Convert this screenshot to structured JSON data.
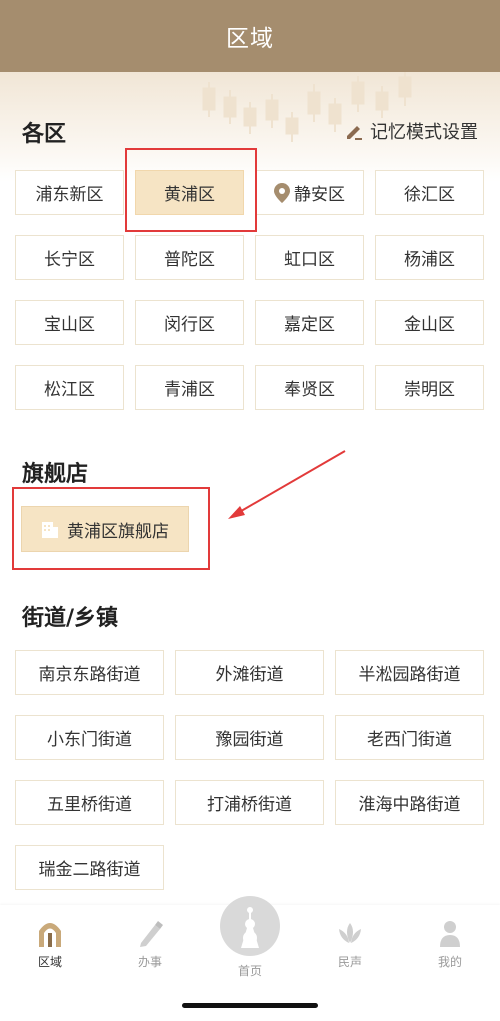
{
  "header": {
    "title": "区域"
  },
  "districts": {
    "title": "各区",
    "memory_setting": "记忆模式设置",
    "items": [
      {
        "label": "浦东新区",
        "selected": false,
        "icon": ""
      },
      {
        "label": "黄浦区",
        "selected": true,
        "icon": ""
      },
      {
        "label": "静安区",
        "selected": false,
        "icon": "location-pin-icon"
      },
      {
        "label": "徐汇区",
        "selected": false,
        "icon": ""
      },
      {
        "label": "长宁区",
        "selected": false,
        "icon": ""
      },
      {
        "label": "普陀区",
        "selected": false,
        "icon": ""
      },
      {
        "label": "虹口区",
        "selected": false,
        "icon": ""
      },
      {
        "label": "杨浦区",
        "selected": false,
        "icon": ""
      },
      {
        "label": "宝山区",
        "selected": false,
        "icon": ""
      },
      {
        "label": "闵行区",
        "selected": false,
        "icon": ""
      },
      {
        "label": "嘉定区",
        "selected": false,
        "icon": ""
      },
      {
        "label": "金山区",
        "selected": false,
        "icon": ""
      },
      {
        "label": "松江区",
        "selected": false,
        "icon": ""
      },
      {
        "label": "青浦区",
        "selected": false,
        "icon": ""
      },
      {
        "label": "奉贤区",
        "selected": false,
        "icon": ""
      },
      {
        "label": "崇明区",
        "selected": false,
        "icon": ""
      }
    ]
  },
  "flagship": {
    "title": "旗舰店",
    "store_label": "黄浦区旗舰店",
    "icon": "building-icon"
  },
  "streets": {
    "title": "街道/乡镇",
    "items": [
      "南京东路街道",
      "外滩街道",
      "半淞园路街道",
      "小东门街道",
      "豫园街道",
      "老西门街道",
      "五里桥街道",
      "打浦桥街道",
      "淮海中路街道",
      "瑞金二路街道"
    ]
  },
  "tabbar": {
    "items": [
      {
        "label": "区域",
        "icon": "region-arch-icon",
        "active": true
      },
      {
        "label": "办事",
        "icon": "pen-icon",
        "active": false
      },
      {
        "label": "首页",
        "icon": "home-tower-icon",
        "active": false
      },
      {
        "label": "民声",
        "icon": "lotus-icon",
        "active": false
      },
      {
        "label": "我的",
        "icon": "person-icon",
        "active": false
      }
    ]
  },
  "colors": {
    "header_bg": "#a58d6e",
    "selected_bg": "#f6e4c4",
    "button_border": "#ece3cf",
    "annotation_red": "#e23a3a",
    "tab_active": "#333333",
    "tab_inactive": "#9a9a9a"
  }
}
